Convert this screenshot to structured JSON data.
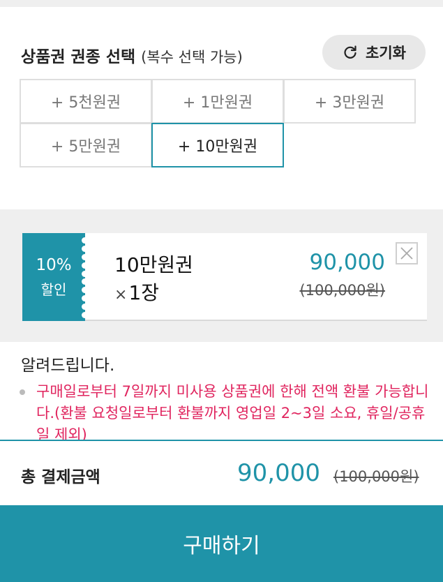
{
  "selection": {
    "title": "상품권 권종 선택",
    "subtitle": "(복수 선택 가능)",
    "reset_label": "초기화",
    "options": [
      {
        "label": "+ 5천원권",
        "selected": false
      },
      {
        "label": "+ 1만원권",
        "selected": false
      },
      {
        "label": "+ 3만원권",
        "selected": false
      },
      {
        "label": "+ 5만원권",
        "selected": false
      },
      {
        "label": "+ 10만원권",
        "selected": true
      }
    ]
  },
  "cart_item": {
    "discount_pct": "10%",
    "discount_label": "할인",
    "name": "10만원권",
    "qty_symbol": "×",
    "qty": "1장",
    "price": "90,000",
    "original_price": "(100,000원)"
  },
  "notice": {
    "title": "알려드립니다.",
    "items": [
      "구매일로부터 7일까지 미사용 상품권에 한해 전액 환불 가능합니다.(환불 요청일로부터 환불까지 영업일 2~3일 소요, 휴일/공휴일 제외)"
    ]
  },
  "total": {
    "label": "총 결제금액",
    "price": "90,000",
    "original_price": "(100,000원)"
  },
  "buy_label": "구매하기",
  "colors": {
    "accent": "#1f93a8",
    "warning": "#e0245e",
    "background": "#efefef"
  }
}
